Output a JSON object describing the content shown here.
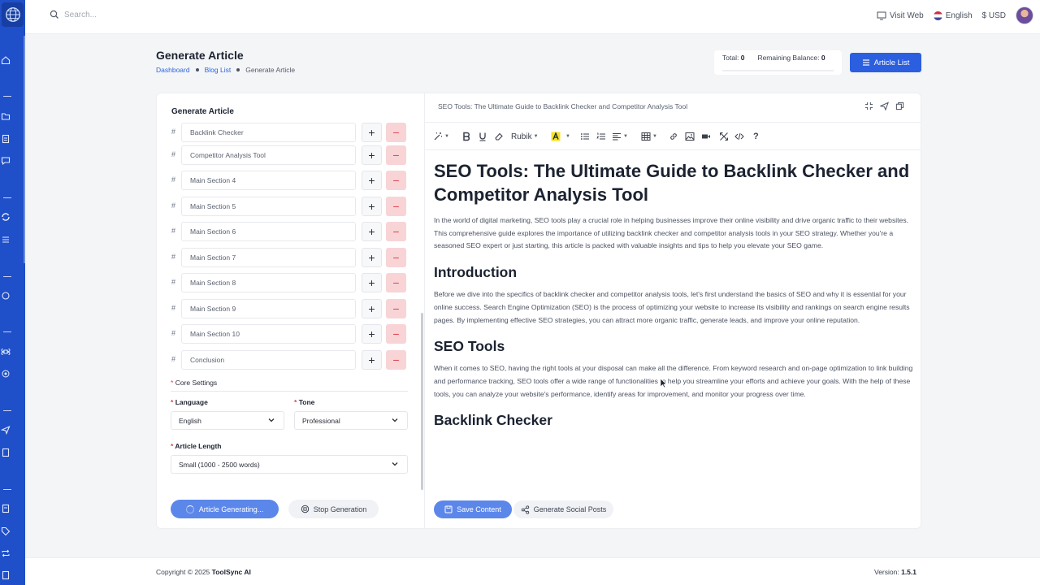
{
  "topbar": {
    "search_placeholder": "Search...",
    "visit_web": "Visit Web",
    "language": "English",
    "currency": "$ USD"
  },
  "header": {
    "title": "Generate Article",
    "breadcrumb": [
      "Dashboard",
      "Blog List",
      "Generate Article"
    ],
    "total_label": "Total:",
    "total_value": "0",
    "balance_label": "Remaining Balance:",
    "balance_value": "0",
    "article_list_button": "Article List"
  },
  "left_panel": {
    "title": "Generate Article",
    "sections": [
      "Backlink Checker",
      "Competitor Analysis Tool",
      "Main Section 4",
      "Main Section 5",
      "Main Section 6",
      "Main Section 7",
      "Main Section 8",
      "Main Section 9",
      "Main Section 10",
      "Conclusion"
    ],
    "hash": "#",
    "add_symbol": "+",
    "remove_symbol": "−",
    "core_settings": "Core Settings",
    "language_label": "Language",
    "language_value": "English",
    "tone_label": "Tone",
    "tone_value": "Professional",
    "length_label": "Article Length",
    "length_value": "Small (1000 - 2500 words)",
    "required_mark": "*",
    "generate_button": "Article Generating...",
    "stop_button": "Stop Generation"
  },
  "editor": {
    "doc_title": "SEO Tools: The Ultimate Guide to Backlink Checker and Competitor Analysis Tool",
    "font_name": "Rubik",
    "help": "?",
    "heading": "SEO Tools: The Ultimate Guide to Backlink Checker and Competitor Analysis Tool",
    "intro": "In the world of digital marketing, SEO tools play a crucial role in helping businesses improve their online visibility and drive organic traffic to their websites. This comprehensive guide explores the importance of utilizing backlink checker and competitor analysis tools in your SEO strategy. Whether you're a seasoned SEO expert or just starting, this article is packed with valuable insights and tips to help you elevate your SEO game.",
    "h_introduction": "Introduction",
    "p_introduction": "Before we dive into the specifics of backlink checker and competitor analysis tools, let's first understand the basics of SEO and why it is essential for your online success. Search Engine Optimization (SEO) is the process of optimizing your website to increase its visibility and rankings on search engine results pages. By implementing effective SEO strategies, you can attract more organic traffic, generate leads, and improve your online reputation.",
    "h_seo_tools": "SEO Tools",
    "p_seo_tools": "When it comes to SEO, having the right tools at your disposal can make all the difference. From keyword research and on-page optimization to link building and performance tracking, SEO tools offer a wide range of functionalities to help you streamline your efforts and achieve your goals. With the help of these tools, you can analyze your website's performance, identify areas for improvement, and monitor your progress over time.",
    "h_backlink": "Backlink Checker",
    "save_button": "Save Content",
    "social_button": "Generate Social Posts"
  },
  "footer": {
    "copyright_prefix": "Copyright © 2025",
    "brand": "ToolSync AI",
    "version_label": "Version:",
    "version_value": "1.5.1"
  },
  "colors": {
    "accent": "#2b5fe0",
    "rail": "#1f4fc9",
    "danger_bg": "#f8d4d6",
    "danger": "#e0424f"
  }
}
